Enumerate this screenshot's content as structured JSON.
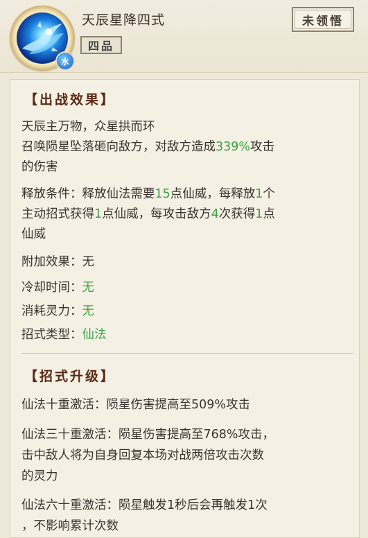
{
  "header": {
    "skill_name": "天辰星降四式",
    "grade": "四品",
    "status": "未领悟",
    "element_badge": "水",
    "icon_name": "star-dragon-icon"
  },
  "battle_effect": {
    "title": "【出战效果】",
    "desc_line1": "天辰主万物，众星拱而环",
    "desc_line2_a": "召唤陨星坠落砸向敌方，对敌方造成",
    "desc_line2_hl": "339%",
    "desc_line2_b": "攻击",
    "desc_line3": "的伤害",
    "release": {
      "p1": "释放条件：释放仙法需要",
      "v1": "15",
      "p2": "点仙威，每释放",
      "v2": "1",
      "p3": "个",
      "p4": "主动招式获得",
      "v3": "1",
      "p5": "点仙威，每攻击敌方",
      "v4": "4",
      "p6": "次获得",
      "v5": "1",
      "p7": "点",
      "p8": "仙威"
    },
    "extra_label": "附加效果：",
    "extra_value": "无",
    "cooldown_label": "冷却时间：",
    "cooldown_value": "无",
    "cost_label": "消耗灵力：",
    "cost_value": "无",
    "type_label": "招式类型：",
    "type_value": "仙法"
  },
  "upgrade": {
    "title": "【招式升级】",
    "l1": "仙法十重激活：陨星伤害提高至509%攻击",
    "l2a": "仙法三十重激活：陨星伤害提高至768%攻击，",
    "l2b": "击中敌人将为自身回复本场对战两倍攻击次数",
    "l2c": "的灵力",
    "l3a": "仙法六十重激活：陨星触发1秒后会再触发1次",
    "l3b": "，不影响累计次数"
  },
  "colors": {
    "highlight": "#3aa23f",
    "section_title": "#5a2a14",
    "background": "#eee8d8"
  }
}
